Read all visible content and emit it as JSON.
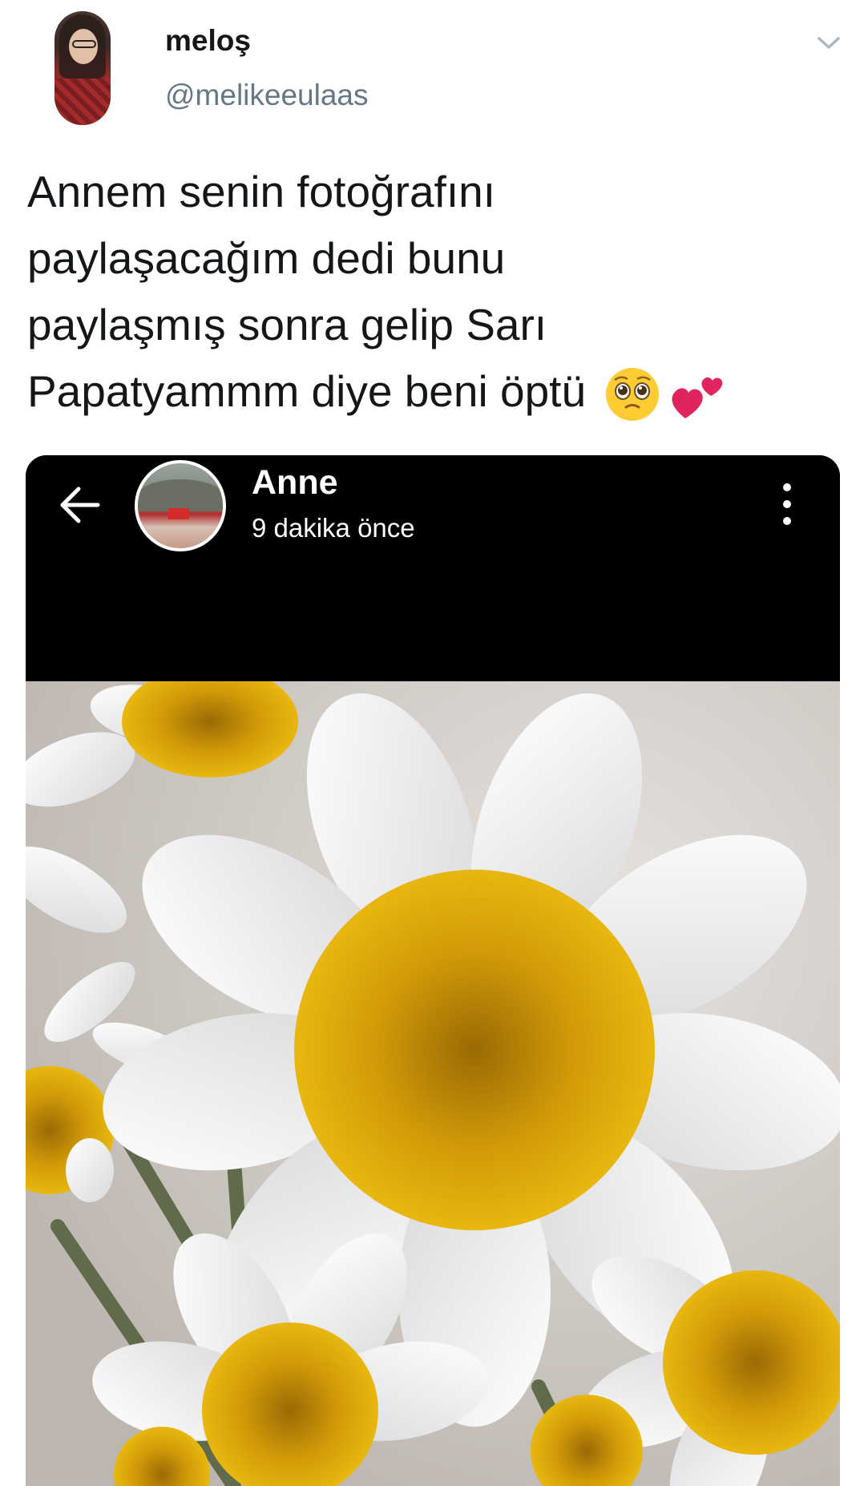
{
  "tweet": {
    "author": {
      "display_name": "meloş",
      "handle": "@melikeeulaas"
    },
    "text_lines": [
      "Annem senin fotoğrafını",
      "paylaşacağım dedi bunu",
      "paylaşmış sonra gelip Sarı",
      "Papatyammm diye beni öptü"
    ],
    "emojis": [
      "pleading-face-emoji",
      "two-hearts-emoji"
    ],
    "menu_icon": "chevron-down-icon"
  },
  "story": {
    "name": "Anne",
    "time": "9 dakika önce",
    "back_icon": "back-arrow-icon",
    "menu_icon": "more-vertical-icon",
    "photo_subject": "daisy-flowers-photo"
  },
  "colors": {
    "text": "#14171a",
    "secondary_text": "#657786",
    "story_bg": "#000000",
    "daisy_yellow": "#e2b20a"
  }
}
